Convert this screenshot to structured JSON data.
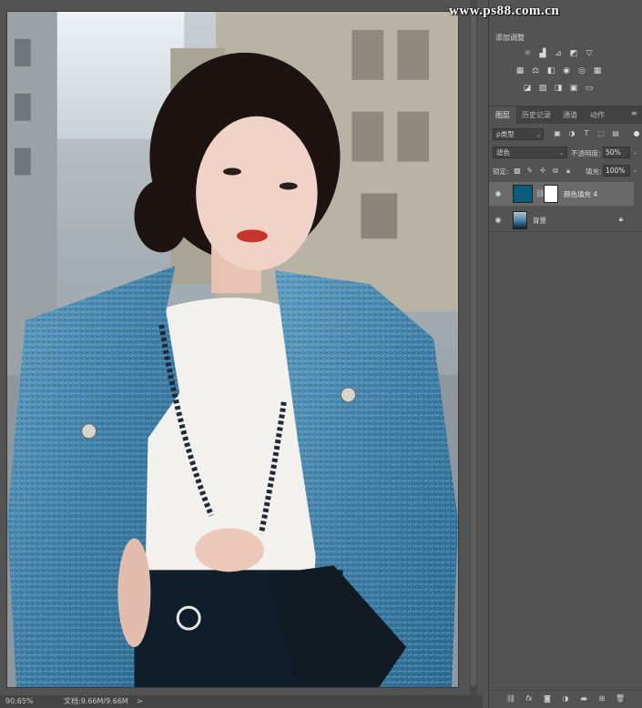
{
  "watermark": {
    "text": "www.ps88.com.cn"
  },
  "status_bar": {
    "zoom": "90.65%",
    "doc_info": "文档:9.66M/9.66M",
    "arrow": ">"
  },
  "adjustments": {
    "title": "添加调整",
    "icons_row1": [
      "brightness-contrast-icon",
      "levels-icon",
      "curves-icon",
      "exposure-icon",
      "vibrance-icon"
    ],
    "icons_row2": [
      "hue-saturation-icon",
      "color-balance-icon",
      "black-white-icon",
      "photo-filter-icon",
      "channel-mixer-icon",
      "color-lookup-icon"
    ],
    "icons_row3": [
      "invert-icon",
      "posterize-icon",
      "threshold-icon",
      "selective-color-icon",
      "gradient-map-icon"
    ]
  },
  "tabs": [
    {
      "label": "图层",
      "active": true
    },
    {
      "label": "历史记录",
      "active": false
    },
    {
      "label": "通道",
      "active": false
    },
    {
      "label": "动作",
      "active": false
    }
  ],
  "filter": {
    "kind_label": "ρ类型",
    "icons": [
      "image-filter-icon",
      "adjustment-filter-icon",
      "type-filter-icon",
      "shape-filter-icon",
      "smart-object-filter-icon"
    ]
  },
  "blend": {
    "mode": "滤色",
    "opacity_label": "不透明度:",
    "opacity_value": "50%"
  },
  "lock": {
    "label": "锁定:",
    "fill_label": "填充:",
    "fill_value": "100%"
  },
  "layers": [
    {
      "name": "颜色填充 4",
      "selected": true,
      "thumb_color": "#0d5b7a",
      "mask": true
    },
    {
      "name": "背景",
      "selected": false,
      "locked": true
    }
  ],
  "footer_icons": [
    "link-icon",
    "fx-icon",
    "mask-icon",
    "adjustment-layer-icon",
    "group-icon",
    "new-layer-icon",
    "trash-icon"
  ],
  "colors": {
    "fill_layer_color": "#0d5b7a",
    "ui_background": "#535353",
    "selected_layer": "#6a6a6a"
  }
}
